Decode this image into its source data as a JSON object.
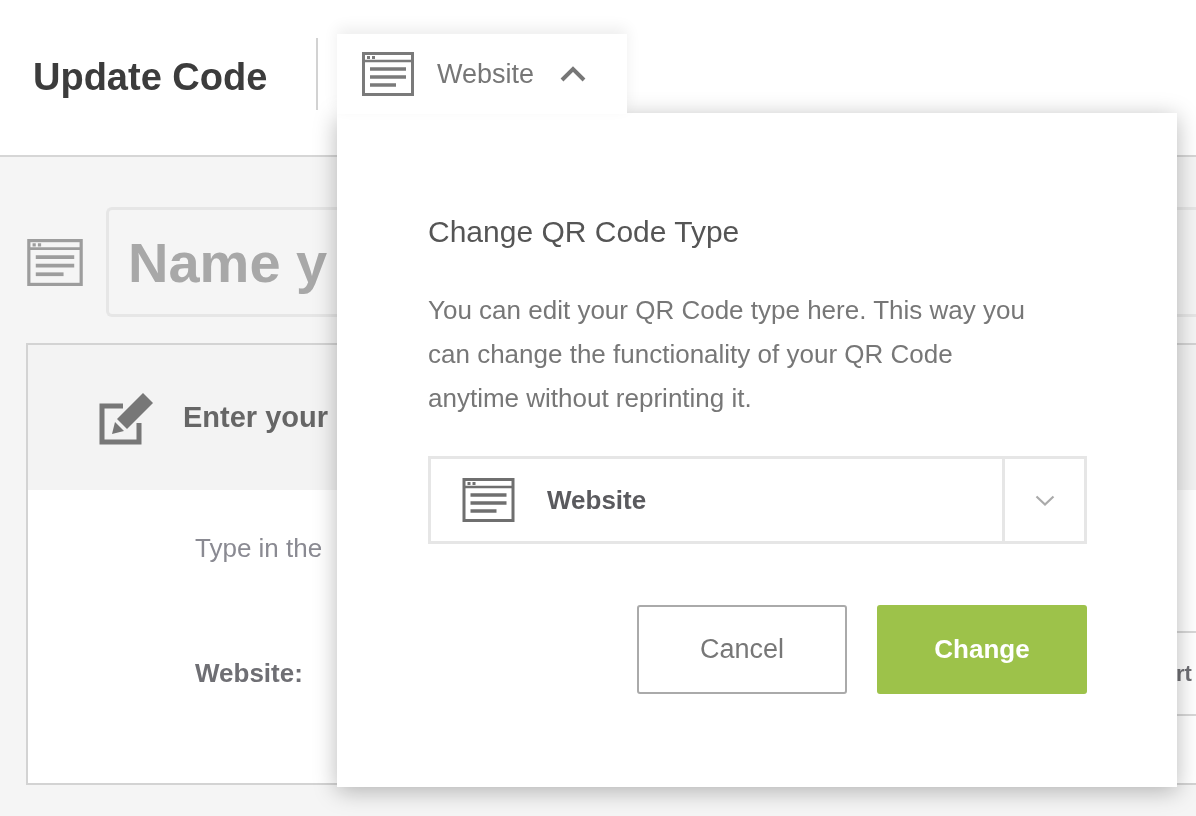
{
  "header": {
    "title": "Update Code",
    "type_button": {
      "label": "Website",
      "expanded": true
    }
  },
  "name_field": {
    "placeholder": "Name y"
  },
  "card": {
    "title": "Enter your",
    "instruction": "Type in the",
    "field_label": "Website:",
    "field_value": "rt"
  },
  "popover": {
    "title": "Change QR Code Type",
    "description": "You can edit your QR Code type here. This way you can change the functionality of your QR Code anytime without reprinting it.",
    "select": {
      "value": "Website"
    },
    "buttons": [
      {
        "label": "Cancel",
        "kind": "secondary"
      },
      {
        "label": "Change",
        "kind": "primary"
      }
    ]
  }
}
